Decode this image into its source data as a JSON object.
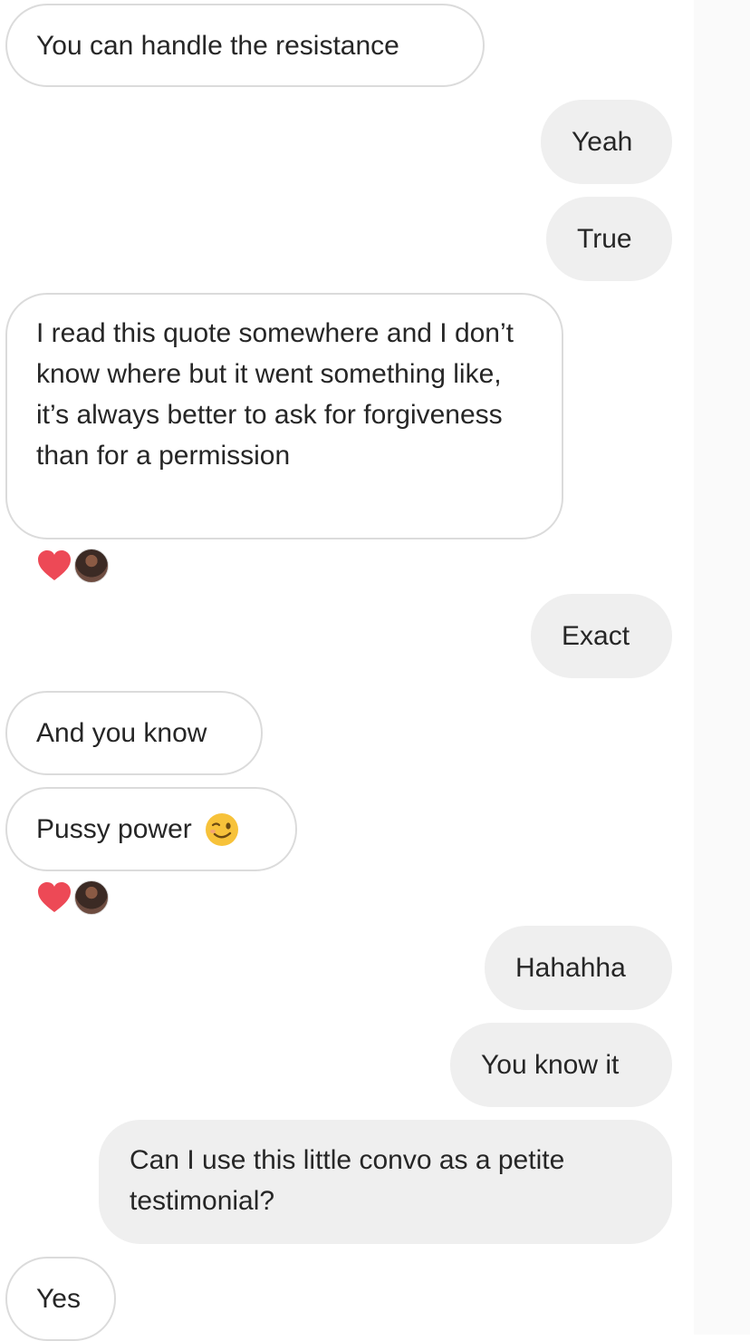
{
  "colors": {
    "incoming_bubble_bg": "#ffffff",
    "incoming_bubble_border": "#dbdbdb",
    "outgoing_bubble_bg": "#efefef",
    "text": "#262626",
    "heart": "#ed4956",
    "emoji_face": "#f7c23a"
  },
  "messages": [
    {
      "direction": "incoming",
      "text": "You can handle the resistance"
    },
    {
      "direction": "outgoing",
      "text": "Yeah"
    },
    {
      "direction": "outgoing",
      "text": "True"
    },
    {
      "direction": "incoming",
      "text": "I read this quote somewhere and I don’t know where but it went something like, it’s always better to ask for forgiveness than for a permission",
      "reaction": "heart-icon"
    },
    {
      "direction": "outgoing",
      "text": "Exact"
    },
    {
      "direction": "incoming",
      "text": "And you know"
    },
    {
      "direction": "incoming",
      "text": "Pussy power",
      "emoji": "winking-face-emoji",
      "reaction": "heart-icon"
    },
    {
      "direction": "outgoing",
      "text": "Hahahha"
    },
    {
      "direction": "outgoing",
      "text": "You know it"
    },
    {
      "direction": "outgoing",
      "text": "Can I use this little convo as a petite testimonial?"
    },
    {
      "direction": "incoming",
      "text": "Yes"
    }
  ]
}
